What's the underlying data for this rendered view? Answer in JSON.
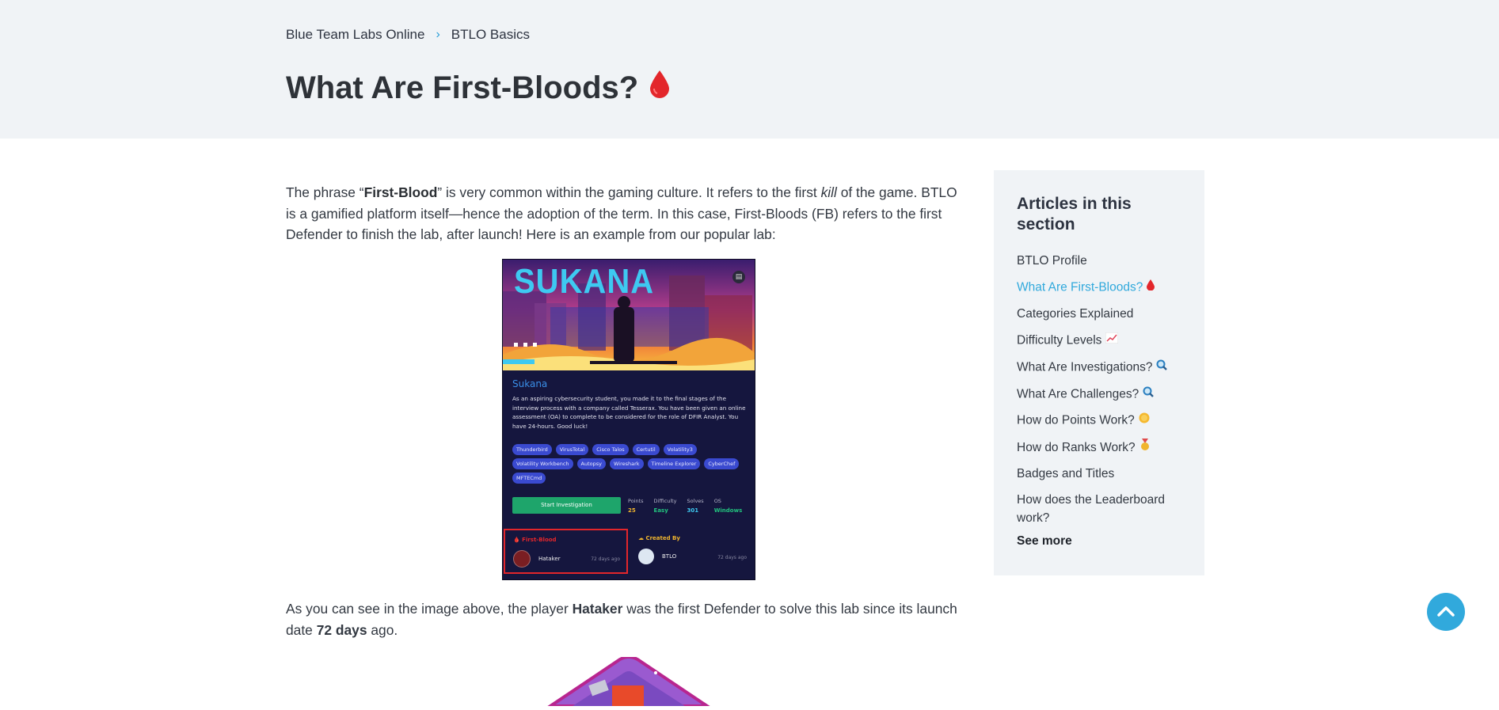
{
  "breadcrumb": {
    "home": "Blue Team Labs Online",
    "separator": "›",
    "current": "BTLO Basics"
  },
  "page": {
    "title": "What Are First-Bloods?",
    "title_icon": "blood-drop-icon"
  },
  "intro": {
    "p1": "The phrase “",
    "b1": "First-Blood",
    "p2": "” is very common within the gaming culture. It refers to the first ",
    "i1": "kill",
    "p3": " of the game. BTLO is a gamified platform itself—hence the adoption of the term. In this case, First-Bloods (FB) refers to the first Defender to finish the lab, after launch! Here is an example from our popular lab:"
  },
  "lab_card": {
    "banner_title": "SUKANA",
    "name": "Sukana",
    "description": "As an aspiring cybersecurity student, you made it to the final stages of the interview process with a company called Tesserax. You have been given an online assessment (OA) to complete to be considered for the role of DFIR Analyst. You have 24-hours. Good luck!",
    "tags": [
      "Thunderbird",
      "VirusTotal",
      "Cisco Talos",
      "Certutil",
      "Volatility3",
      "Volatility Workbench",
      "Autopsy",
      "Wireshark",
      "Timeline Explorer",
      "CyberChef",
      "MFTECmd"
    ],
    "start_button": "Start Investigation",
    "stats": [
      {
        "label": "Points",
        "value": "25",
        "color": "#f0b52e"
      },
      {
        "label": "Difficulty",
        "value": "Easy",
        "color": "#22c27e"
      },
      {
        "label": "Solves",
        "value": "301",
        "color": "#3ec9f1"
      },
      {
        "label": "OS",
        "value": "Windows",
        "color": "#22c27e"
      }
    ],
    "first_blood": {
      "heading": "First-Blood",
      "user": "Hataker",
      "ago": "72 days ago"
    },
    "created_by": {
      "heading": "Created By",
      "user": "BTLO",
      "ago": "72 days ago"
    }
  },
  "after": {
    "p1": "As you can see in the image above, the player ",
    "b1": "Hataker",
    "p2": " was the first Defender to solve this lab since its launch date ",
    "b2": "72 days",
    "p3": " ago."
  },
  "sidebar": {
    "title": "Articles in this section",
    "items": [
      {
        "label": "BTLO Profile",
        "icon": ""
      },
      {
        "label": "What Are First-Bloods?",
        "icon": "blood-drop-icon",
        "active": true
      },
      {
        "label": "Categories Explained",
        "icon": ""
      },
      {
        "label": "Difficulty Levels",
        "icon": "chart-increasing-icon"
      },
      {
        "label": "What Are Investigations?",
        "icon": "magnifying-glass-icon"
      },
      {
        "label": "What Are Challenges?",
        "icon": "magnifying-glass-icon"
      },
      {
        "label": "How do Points Work?",
        "icon": "coin-icon"
      },
      {
        "label": "How do Ranks Work?",
        "icon": "medal-icon"
      },
      {
        "label": "Badges and Titles",
        "icon": ""
      },
      {
        "label": "How does the Leaderboard work?",
        "icon": ""
      }
    ],
    "see_more": "See more"
  },
  "colors": {
    "accent": "#31a9dc",
    "hero_bg": "#f0f3f6",
    "first_blood_red": "#e3262b"
  }
}
